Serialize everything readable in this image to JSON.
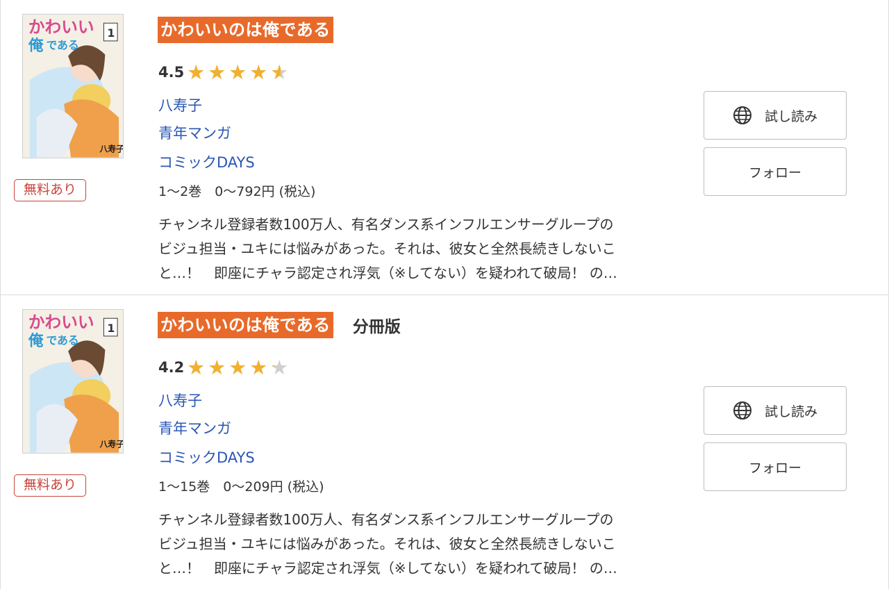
{
  "items": [
    {
      "cover_author_mark": "八寿子",
      "free_badge": "無料あり",
      "title": "かわいいのは俺である",
      "edition": "",
      "rating": "4.5",
      "rating_value": 4.5,
      "author": "八寿子",
      "genre": "青年マンガ",
      "publisher": "コミックDAYS",
      "price": "1〜2巻　0〜792円 (税込)",
      "description": [
        "チャンネル登録者数100万人、有名ダンス系インフルエンサーグループの",
        "ビジュ担当・ユキには悩みがあった。それは、彼女と全然長続きしないこ",
        "と…！　即座にチャラ認定され浮気（※してない）を疑われて破局！ の…"
      ],
      "trial_label": "試し読み",
      "follow_label": "フォロー"
    },
    {
      "cover_author_mark": "八寿子",
      "free_badge": "無料あり",
      "title": "かわいいのは俺である",
      "edition": "分冊版",
      "rating": "4.2",
      "rating_value": 4.2,
      "author": "八寿子",
      "genre": "青年マンガ",
      "publisher": "コミックDAYS",
      "price": "1〜15巻　0〜209円 (税込)",
      "description": [
        "チャンネル登録者数100万人、有名ダンス系インフルエンサーグループの",
        "ビジュ担当・ユキには悩みがあった。それは、彼女と全然長続きしないこ",
        "と…！　即座にチャラ認定され浮気（※してない）を疑われて破局！ の…"
      ],
      "trial_label": "試し読み",
      "follow_label": "フォロー"
    }
  ],
  "colors": {
    "title_highlight": "#e86a2b",
    "link": "#2a56b5",
    "star": "#f2b02e",
    "badge": "#c9423a"
  }
}
